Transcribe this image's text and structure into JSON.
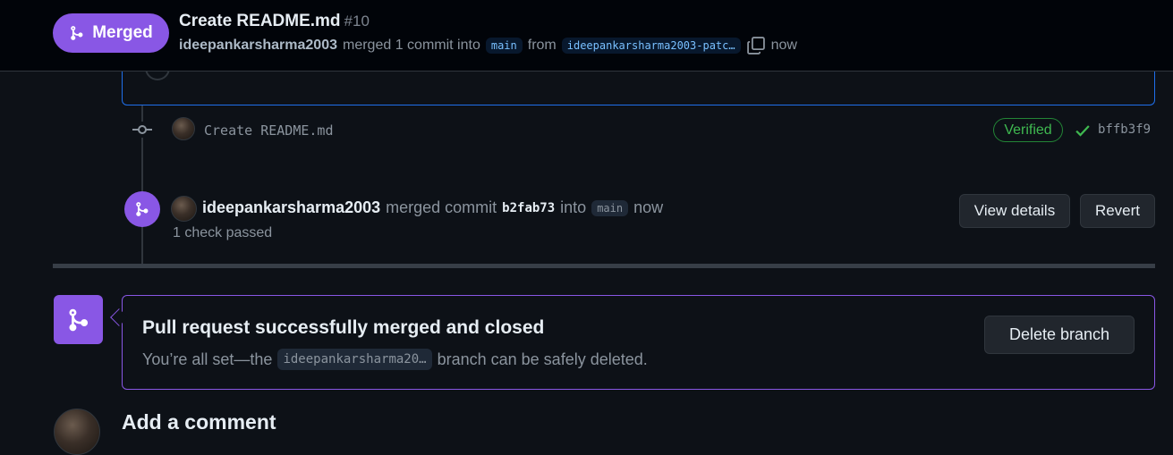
{
  "header": {
    "badge_label": "Merged",
    "pr_title": "Create README.md",
    "pr_number": "#10",
    "author": "ideepankarsharma2003",
    "merged_text": "merged 1 commit into",
    "base_branch": "main",
    "from_text": "from",
    "head_branch": "ideepankarsharma2003-patc…",
    "time": "now"
  },
  "commit": {
    "message": "Create README.md",
    "verified_label": "Verified",
    "sha": "bffb3f9"
  },
  "merge_event": {
    "author": "ideepankarsharma2003",
    "action": "merged commit",
    "sha": "b2fab73",
    "into_text": "into",
    "branch": "main",
    "time": "now",
    "checks": "1 check passed",
    "view_details_label": "View details",
    "revert_label": "Revert"
  },
  "status": {
    "title": "Pull request successfully merged and closed",
    "desc_prefix": "You’re all set—the",
    "branch": "ideepankarsharma20…",
    "desc_suffix": "branch can be safely deleted.",
    "delete_label": "Delete branch"
  },
  "comment": {
    "heading": "Add a comment"
  },
  "colors": {
    "merged_purple": "#8957e5",
    "verified_green": "#3fb950",
    "background": "#0d1117"
  }
}
